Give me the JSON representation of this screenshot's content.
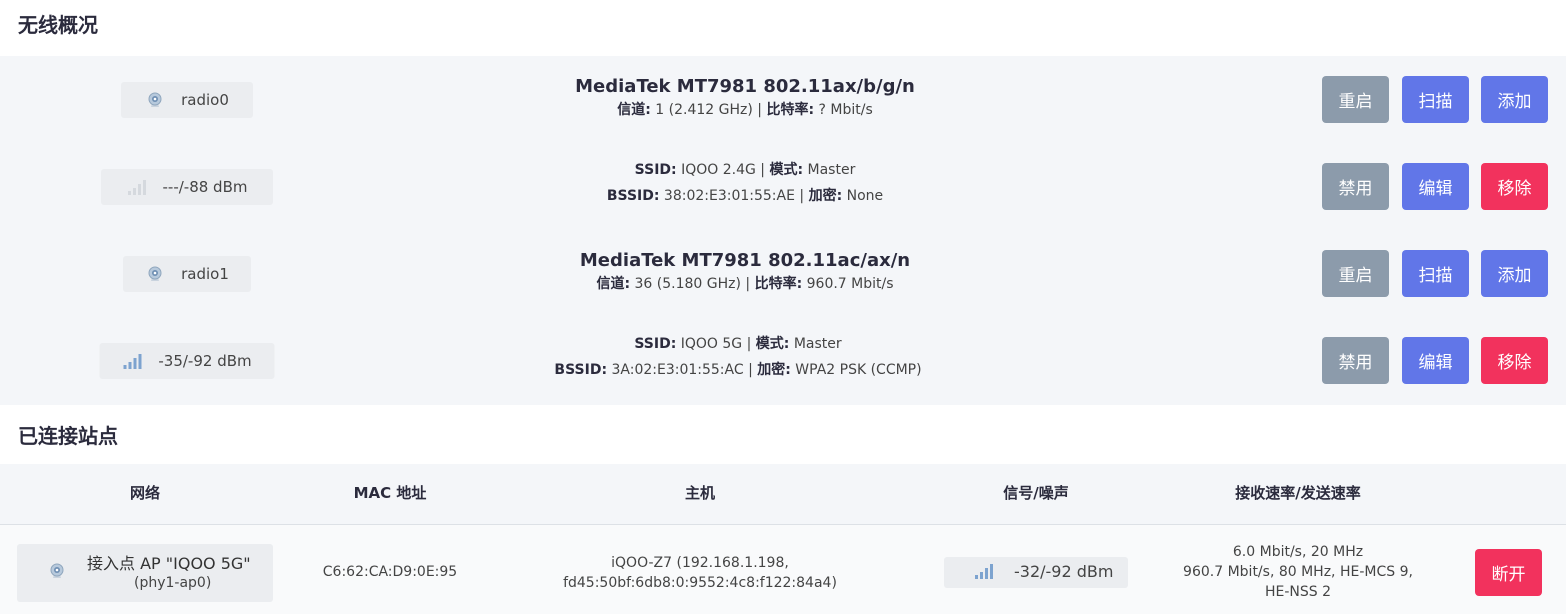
{
  "wireless_overview": {
    "title": "无线概况",
    "rows": [
      {
        "kind": "radio",
        "badge_label": "radio0",
        "badge_icon": "wifi-radio-icon",
        "device_name": "MediaTek MT7981 802.11ax/b/g/n",
        "channel_label": "信道:",
        "channel_value": " 1 (2.412 GHz) | ",
        "bitrate_label": "比特率:",
        "bitrate_value": " ? Mbit/s",
        "buttons": [
          "重启",
          "扫描",
          "添加"
        ]
      },
      {
        "kind": "iface",
        "badge_label": "---/-88 dBm",
        "badge_icon": "signal-none-icon",
        "ssid_label": "SSID:",
        "ssid_value": " IQOO 2.4G | ",
        "mode_label": "模式:",
        "mode_value": " Master",
        "bssid_label": "BSSID:",
        "bssid_value": " 38:02:E3:01:55:AE | ",
        "enc_label": "加密:",
        "enc_value": " None",
        "buttons": [
          "禁用",
          "编辑",
          "移除"
        ]
      },
      {
        "kind": "radio",
        "badge_label": "radio1",
        "badge_icon": "wifi-radio-icon",
        "device_name": "MediaTek MT7981 802.11ac/ax/n",
        "channel_label": "信道:",
        "channel_value": " 36 (5.180 GHz) | ",
        "bitrate_label": "比特率:",
        "bitrate_value": " 960.7 Mbit/s",
        "buttons": [
          "重启",
          "扫描",
          "添加"
        ]
      },
      {
        "kind": "iface",
        "badge_label": "-35/-92 dBm",
        "badge_icon": "signal-strong-icon",
        "ssid_label": "SSID:",
        "ssid_value": " IQOO 5G | ",
        "mode_label": "模式:",
        "mode_value": " Master",
        "bssid_label": "BSSID:",
        "bssid_value": " 3A:02:E3:01:55:AC | ",
        "enc_label": "加密:",
        "enc_value": " WPA2 PSK (CCMP)",
        "buttons": [
          "禁用",
          "编辑",
          "移除"
        ]
      }
    ]
  },
  "connected_stations": {
    "title": "已连接站点",
    "headers": [
      "网络",
      "MAC 地址",
      "主机",
      "信号/噪声",
      "接收速率/发送速率"
    ],
    "rows": [
      {
        "network_line1": "接入点 AP \"IQOO 5G\"",
        "network_line2": "(phy1-ap0)",
        "network_icon": "wifi-radio-icon",
        "mac": "C6:62:CA:D9:0E:95",
        "host_line1": "iQOO-Z7 (192.168.1.198,",
        "host_line2": "fd45:50bf:6db8:0:9552:4c8:f122:84a4)",
        "signal": "-32/-92 dBm",
        "signal_icon": "signal-strong-icon",
        "rate_line1": "6.0 Mbit/s, 20 MHz",
        "rate_line2": "960.7 Mbit/s, 80 MHz, HE-MCS 9,",
        "rate_line3": "HE-NSS 2",
        "disconnect_label": "断开"
      }
    ]
  },
  "colors": {
    "button_gray": "#8c9bab",
    "button_blue": "#6176e8",
    "button_red": "#f2325d",
    "panel_bg": "#f4f6f9"
  }
}
